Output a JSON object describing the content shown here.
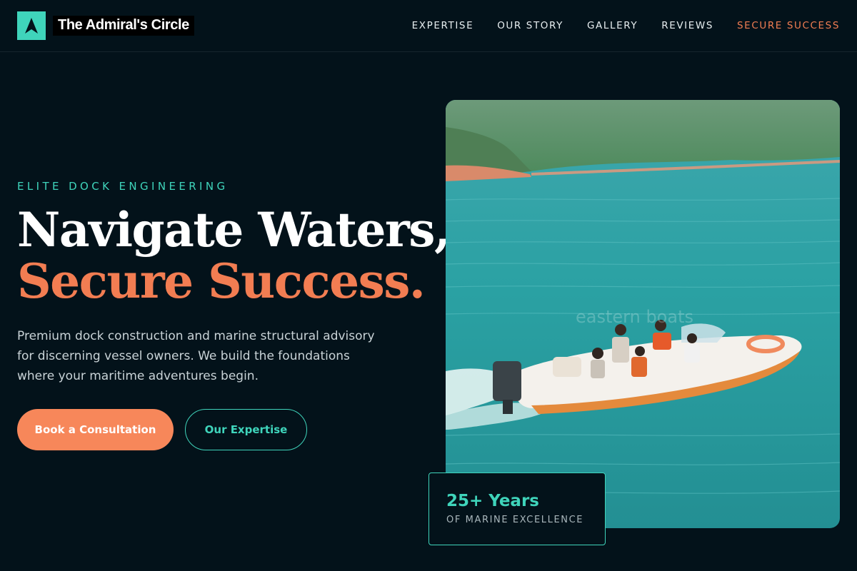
{
  "brand": {
    "name": "The Admiral's Circle",
    "logo_icon": "navigation-arrow-icon",
    "logo_color": "#3fd4bb"
  },
  "nav": {
    "links": [
      "EXPERTISE",
      "OUR STORY",
      "GALLERY",
      "REVIEWS"
    ],
    "cta": "SECURE SUCCESS"
  },
  "hero": {
    "eyebrow": "ELITE DOCK ENGINEERING",
    "headline_line1": "Navigate Waters,",
    "headline_line2": "Secure Success.",
    "description": "Premium dock construction and marine structural advisory for discerning vessel owners. We build the foundations where your maritime adventures begin.",
    "primary_button": "Book a Consultation",
    "secondary_button": "Our Expertise",
    "image_watermark": "eastern boats"
  },
  "stat": {
    "value": "25+ Years",
    "label": "OF MARINE EXCELLENCE"
  },
  "colors": {
    "background": "#03121a",
    "accent_teal": "#3fd4bb",
    "accent_coral": "#f27d52",
    "button_coral": "#f7875a"
  }
}
